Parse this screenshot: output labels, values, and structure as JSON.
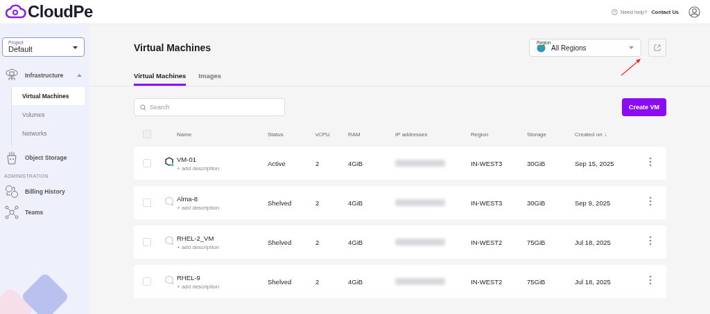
{
  "header": {
    "logo": "CloudPe",
    "help": "Need help?",
    "contact": "Contact Us"
  },
  "sidebar": {
    "project_label": "Project",
    "project": "Default",
    "sections": [
      {
        "items": [
          {
            "label": "Infrastructure",
            "kind": "server",
            "expanded": true,
            "children": [
              {
                "label": "Virtual Machines",
                "selected": true
              },
              {
                "label": "Volumes",
                "selected": false
              },
              {
                "label": "Networks",
                "selected": false
              }
            ]
          },
          {
            "label": "Object Storage",
            "kind": "bucket"
          }
        ]
      },
      {
        "heading": "ADMINISTRATION",
        "items": [
          {
            "label": "Billing History",
            "kind": "billing"
          },
          {
            "label": "Teams",
            "kind": "teams"
          }
        ]
      }
    ]
  },
  "page": {
    "title": "Virtual Machines",
    "region_label": "Region",
    "region": "All Regions",
    "tabs": [
      {
        "label": "Virtual Machines",
        "selected": true
      },
      {
        "label": "Images",
        "selected": false
      }
    ],
    "search": {
      "placeholder": "Search"
    },
    "create_button": "Create VM",
    "table": {
      "columns": [
        "Name",
        "Status",
        "vCPU",
        "RAM",
        "IP addresses",
        "Region",
        "Storage",
        "Created on"
      ],
      "sort_mark": "↓",
      "all_checked": false,
      "rows": [
        {
          "name": "VM-01",
          "description": "+ add description",
          "status": "Active",
          "running": true,
          "checked": false,
          "vcpu": "2",
          "ram": "4GiB",
          "region": "IN-WEST3",
          "storage": "30GiB",
          "created": "Sep 15, 2025"
        },
        {
          "name": "Alma-8",
          "description": "+ add description",
          "status": "Shelved",
          "running": false,
          "checked": false,
          "vcpu": "2",
          "ram": "4GiB",
          "region": "IN-WEST3",
          "storage": "30GiB",
          "created": "Sep 9, 2025"
        },
        {
          "name": "RHEL-2_VM",
          "description": "+ add description",
          "status": "Shelved",
          "running": false,
          "checked": false,
          "vcpu": "2",
          "ram": "4GiB",
          "region": "IN-WEST2",
          "storage": "75GiB",
          "created": "Jul 18, 2025"
        },
        {
          "name": "RHEL-9",
          "description": "+ add description",
          "status": "Shelved",
          "running": false,
          "checked": false,
          "vcpu": "2",
          "ram": "4GiB",
          "region": "IN-WEST2",
          "storage": "75GiB",
          "created": "Jul 18, 2025"
        }
      ]
    }
  }
}
